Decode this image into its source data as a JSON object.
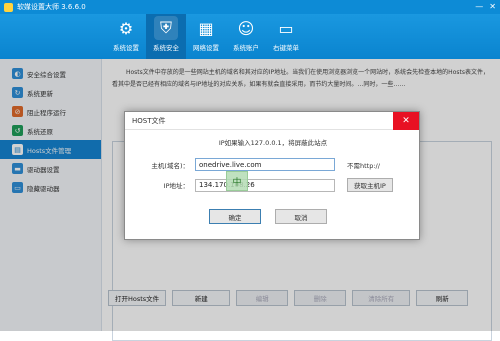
{
  "window": {
    "title": "软媒设置大师 3.6.6.0",
    "minimize": "—",
    "close": "✕",
    "colors": {
      "accent": "#0d8bd6",
      "selected": "#1584d2",
      "close_red": "#e81123"
    }
  },
  "toolbar": [
    {
      "label": "系统设置",
      "icon": "monitor-gear-icon",
      "glyph": "⚙"
    },
    {
      "label": "系统安全",
      "icon": "shield-icon",
      "glyph": "⛨"
    },
    {
      "label": "网络设置",
      "icon": "network-icon",
      "glyph": "▦"
    },
    {
      "label": "系统账户",
      "icon": "user-icon",
      "glyph": "☺"
    },
    {
      "label": "右键菜单",
      "icon": "mouse-icon",
      "glyph": "▭"
    }
  ],
  "sidebar": [
    {
      "label": "安全综合设置",
      "icon": "security-icon",
      "color": "#2f8fd8"
    },
    {
      "label": "系统更新",
      "icon": "update-icon",
      "color": "#2f8fd8"
    },
    {
      "label": "阻止程序运行",
      "icon": "block-icon",
      "color": "#e06a2a"
    },
    {
      "label": "系统还原",
      "icon": "restore-icon",
      "color": "#1f9e5a"
    },
    {
      "label": "Hosts文件管理",
      "icon": "hosts-icon",
      "color": "#ffffff"
    },
    {
      "label": "驱动器设置",
      "icon": "drive-icon",
      "color": "#2f8fd8"
    },
    {
      "label": "隐藏驱动器",
      "icon": "hide-drive-icon",
      "color": "#2f8fd8"
    }
  ],
  "main": {
    "description": "Hosts文件中存放的是一些网站主机的域名和其对应的IP地址。当我们在使用浏览器浏览一个网站时，系统会先检查本地的Hosts表文件，看其中是否已经有相应的域名与IP地址的对应关系，如果有就会直接采用，而节约大量时间。…同时，一些……",
    "buttons": [
      {
        "label": "打开Hosts文件",
        "enabled": true
      },
      {
        "label": "新建",
        "enabled": true
      },
      {
        "label": "编辑",
        "enabled": false
      },
      {
        "label": "删除",
        "enabled": false
      },
      {
        "label": "清除所有",
        "enabled": false
      },
      {
        "label": "刷新",
        "enabled": true
      }
    ]
  },
  "dialog": {
    "title": "HOST文件",
    "close": "✕",
    "hint": "IP如果输入127.0.0.1，将屏蔽此站点",
    "host_label": "主机(域名)：",
    "host_value": "onedrive.live.com",
    "host_note": "不需http://",
    "ip_label": "IP地址：",
    "ip_value": "134.170.108.26",
    "get_ip_button": "获取主机IP",
    "ok_button": "确定",
    "cancel_button": "取消"
  },
  "ime_badge": "中"
}
